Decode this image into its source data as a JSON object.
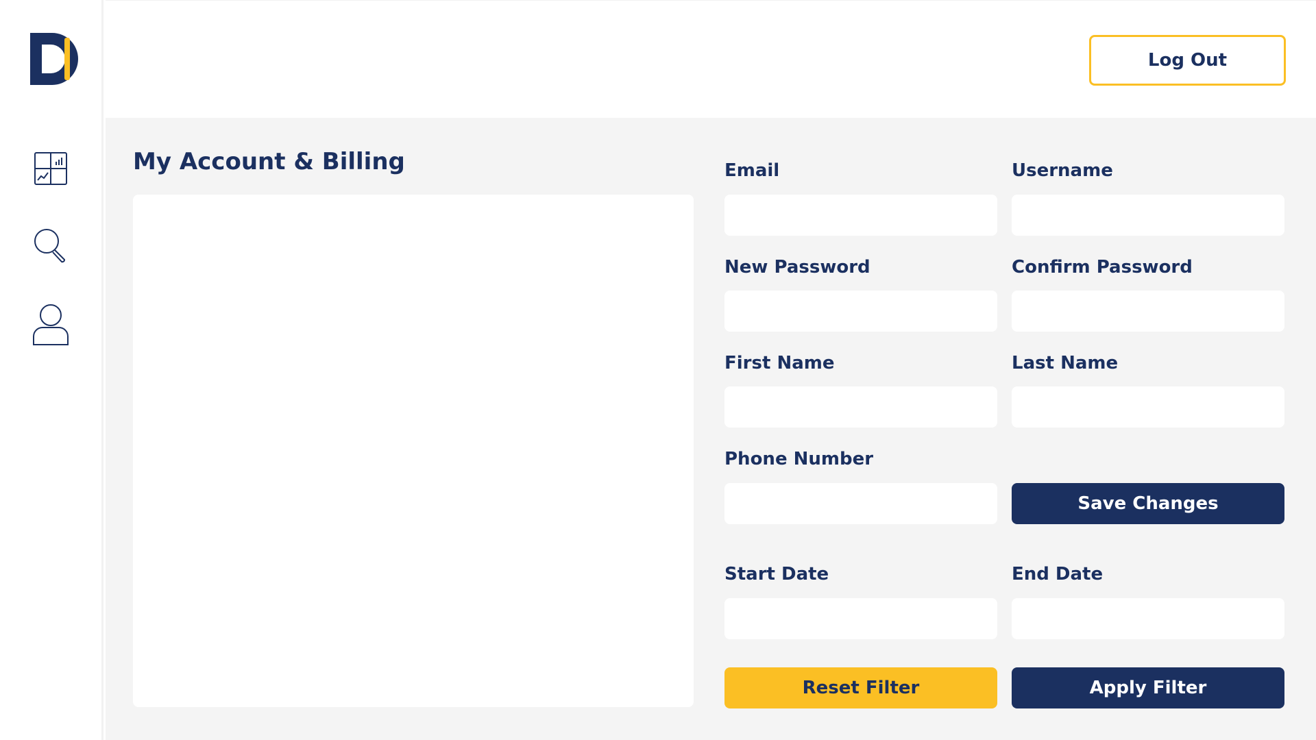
{
  "header": {
    "logout_label": "Log Out"
  },
  "sidebar": {
    "items": [
      {
        "name": "dashboard",
        "icon": "dashboard-chart-icon"
      },
      {
        "name": "search",
        "icon": "search-icon"
      },
      {
        "name": "profile",
        "icon": "user-icon"
      }
    ]
  },
  "page": {
    "title": "My Account & Billing"
  },
  "form": {
    "email_label": "Email",
    "email_value": "",
    "username_label": "Username",
    "username_value": "",
    "new_password_label": "New Password",
    "new_password_value": "",
    "confirm_password_label": "Confirm Password",
    "confirm_password_value": "",
    "first_name_label": "First Name",
    "first_name_value": "",
    "last_name_label": "Last Name",
    "last_name_value": "",
    "phone_label": "Phone Number",
    "phone_value": "",
    "save_label": "Save Changes"
  },
  "filter": {
    "start_date_label": "Start Date",
    "start_date_value": "",
    "end_date_label": "End Date",
    "end_date_value": "",
    "reset_label": "Reset Filter",
    "apply_label": "Apply Filter"
  },
  "colors": {
    "navy": "#1b3060",
    "yellow": "#fbbf24",
    "background": "#f4f4f4"
  }
}
